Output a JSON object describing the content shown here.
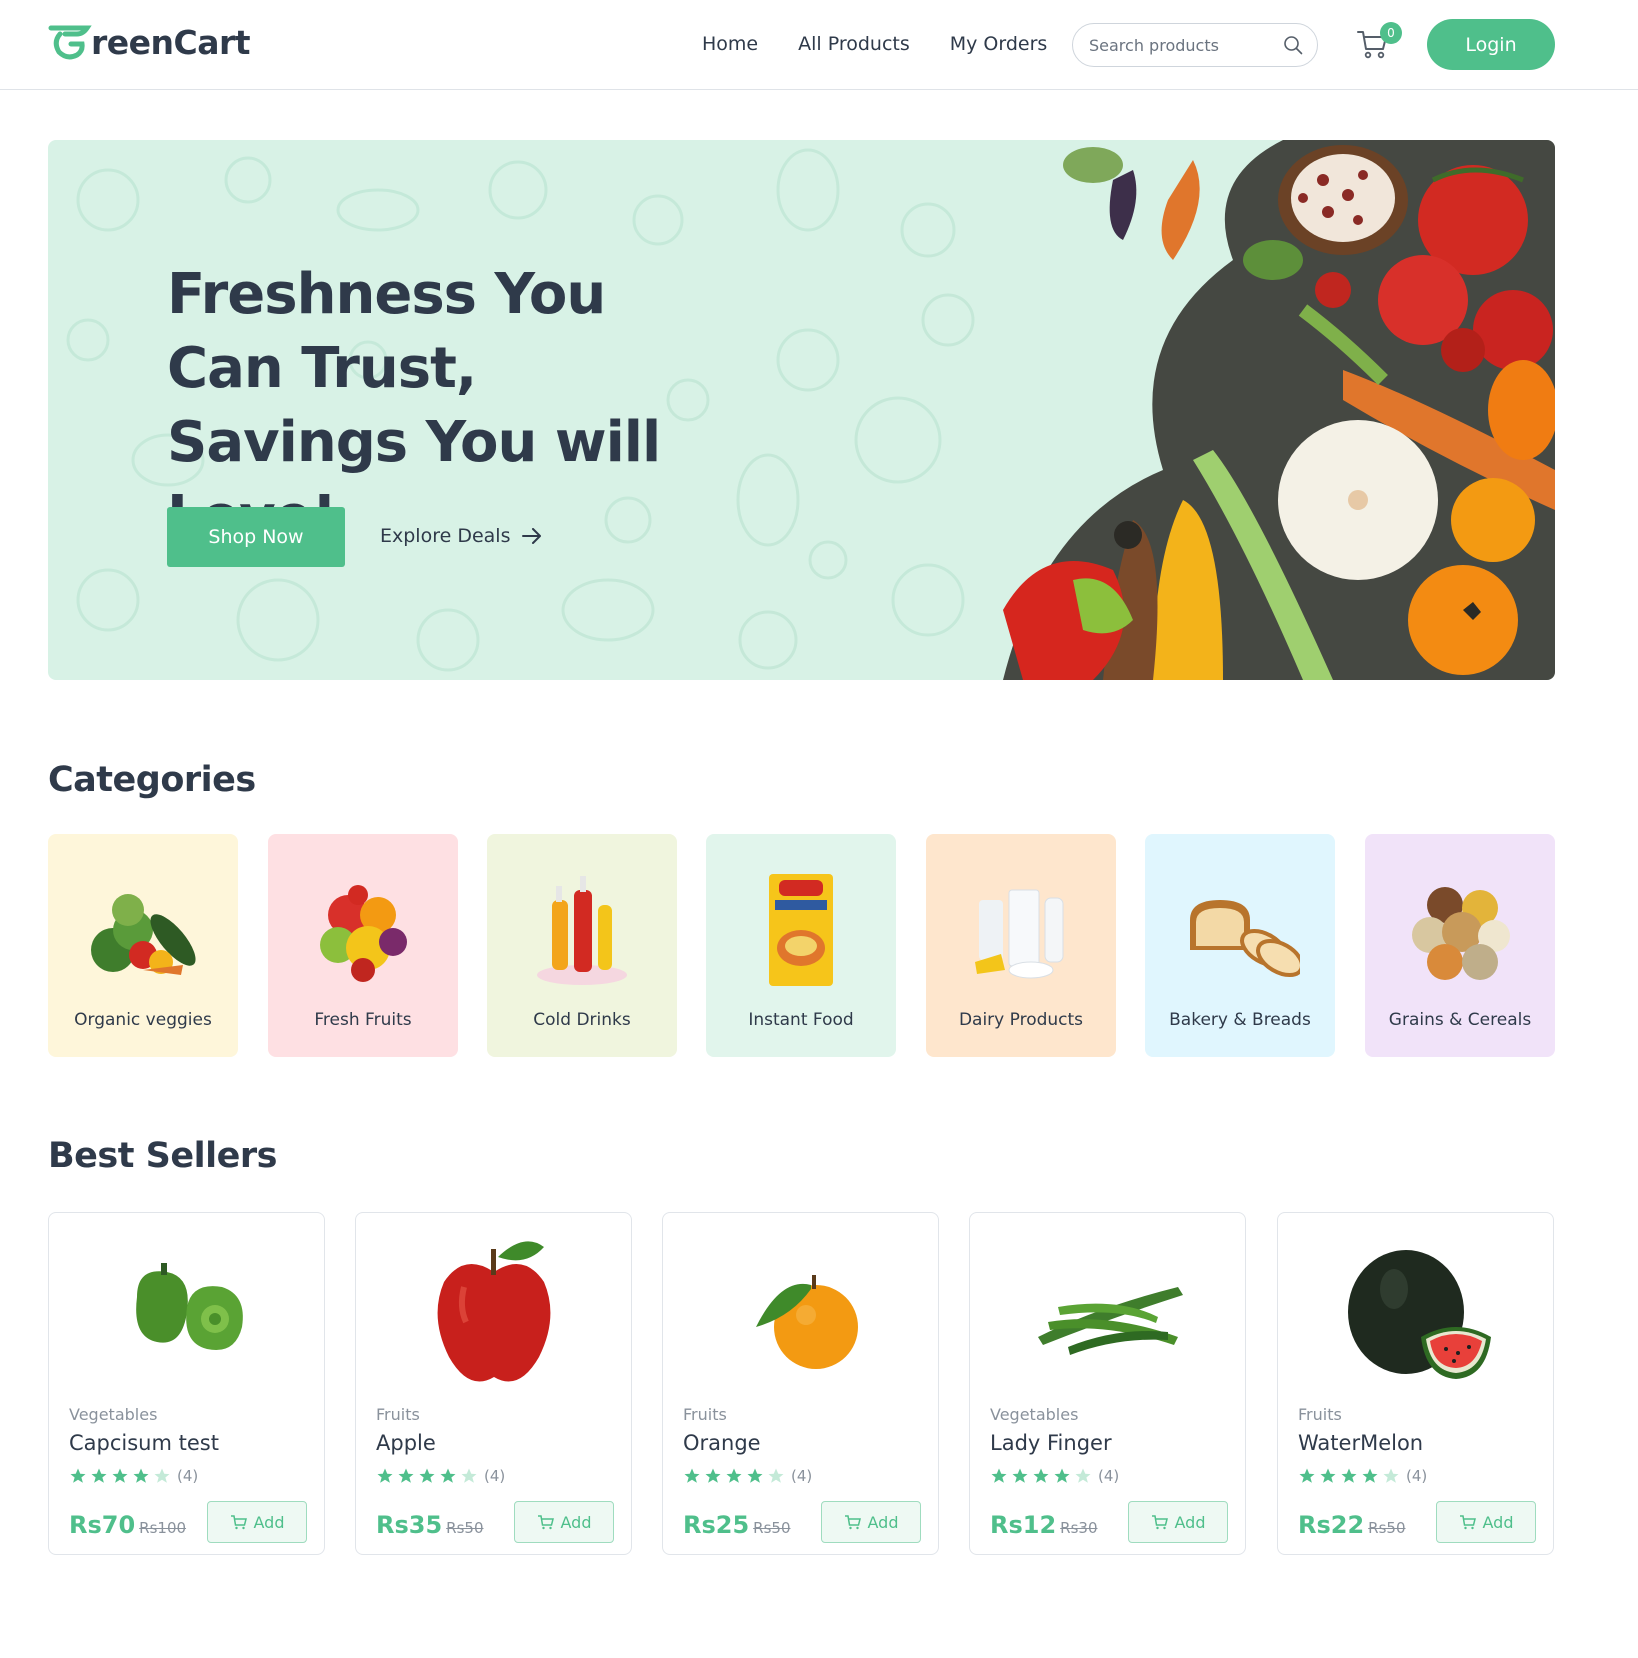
{
  "brand": {
    "name": "reenCart",
    "accent": "#4fbf8b"
  },
  "nav": {
    "links": [
      "Home",
      "All Products",
      "My Orders"
    ],
    "search_placeholder": "Search products",
    "cart_count": "0",
    "login_label": "Login"
  },
  "hero": {
    "title": "Freshness You Can Trust, Savings You will Love!",
    "primary_cta": "Shop Now",
    "secondary_cta": "Explore Deals",
    "background": "#d8f2e6"
  },
  "categories": {
    "title": "Categories",
    "items": [
      {
        "label": "Organic veggies",
        "bg": "#fef6da",
        "icon": "veggies-image"
      },
      {
        "label": "Fresh Fruits",
        "bg": "#fee0e3",
        "icon": "fruits-image"
      },
      {
        "label": "Cold Drinks",
        "bg": "#f0f5de",
        "icon": "drinks-image"
      },
      {
        "label": "Instant Food",
        "bg": "#e1f5ec",
        "icon": "noodles-image"
      },
      {
        "label": "Dairy Products",
        "bg": "#fee6cd",
        "icon": "dairy-image"
      },
      {
        "label": "Bakery & Breads",
        "bg": "#e0f6fe",
        "icon": "bread-image"
      },
      {
        "label": "Grains & Cereals",
        "bg": "#f1e3f9",
        "icon": "grains-image"
      }
    ]
  },
  "best_sellers": {
    "title": "Best Sellers",
    "add_label": "Add",
    "products": [
      {
        "category": "Vegetables",
        "name": "Capcisum test",
        "rating": 4,
        "rating_label": "(4)",
        "price": "Rs70",
        "old_price": "Rs100",
        "icon": "capsicum-image"
      },
      {
        "category": "Fruits",
        "name": "Apple",
        "rating": 4,
        "rating_label": "(4)",
        "price": "Rs35",
        "old_price": "Rs50",
        "icon": "apple-image"
      },
      {
        "category": "Fruits",
        "name": "Orange",
        "rating": 4,
        "rating_label": "(4)",
        "price": "Rs25",
        "old_price": "Rs50",
        "icon": "orange-image"
      },
      {
        "category": "Vegetables",
        "name": "Lady Finger",
        "rating": 4,
        "rating_label": "(4)",
        "price": "Rs12",
        "old_price": "Rs30",
        "icon": "okra-image"
      },
      {
        "category": "Fruits",
        "name": "WaterMelon",
        "rating": 4,
        "rating_label": "(4)",
        "price": "Rs22",
        "old_price": "Rs50",
        "icon": "watermelon-image"
      }
    ]
  }
}
